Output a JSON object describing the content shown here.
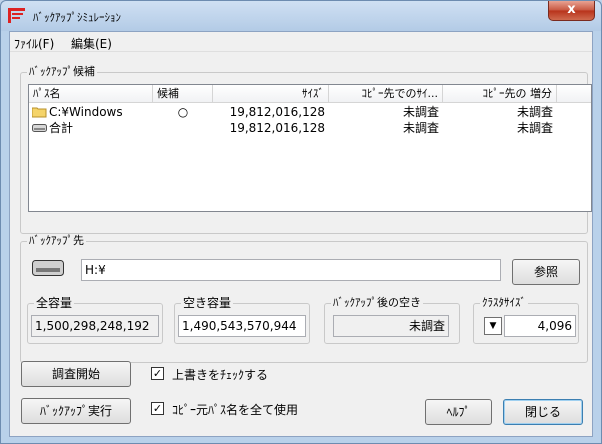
{
  "window": {
    "title": "ﾊﾞｯｸｱｯﾌﾟｼﾐｭﾚｰｼｮﾝ",
    "close_label": "x"
  },
  "menu": {
    "file": "ﾌｧｲﾙ(F)",
    "edit": "編集(E)"
  },
  "candidates": {
    "group_label": "ﾊﾞｯｸｱｯﾌﾟ候補",
    "columns": [
      "ﾊﾟｽ名",
      "候補",
      "ｻｲｽﾞ",
      "ｺﾋﾟｰ先でのｻｲ...",
      "ｺﾋﾟｰ先の 増分"
    ],
    "rows": [
      {
        "icon": "folder-icon",
        "path": "C:¥Windows",
        "candidate": "○",
        "size": "19,812,016,128",
        "dest_size": "未調査",
        "increment": "未調査"
      },
      {
        "icon": "drive-icon",
        "path": "合計",
        "candidate": "",
        "size": "19,812,016,128",
        "dest_size": "未調査",
        "increment": "未調査"
      }
    ]
  },
  "destination": {
    "group_label": "ﾊﾞｯｸｱｯﾌﾟ先",
    "path": "H:¥",
    "browse_label": "参照",
    "total_label": "全容量",
    "total_value": "1,500,298,248,192",
    "free_label": "空き容量",
    "free_value": "1,490,543,570,944",
    "after_label": "ﾊﾞｯｸｱｯﾌﾟ後の空き",
    "after_value": "未調査",
    "cluster_label": "ｸﾗｽﾀｻｲｽﾞ",
    "cluster_value": "4,096"
  },
  "actions": {
    "scan_label": "調査開始",
    "run_label": "ﾊﾞｯｸｱｯﾌﾟ実行",
    "overwrite_check_label": "上書きをﾁｪｯｸする",
    "overwrite_checked": "✓",
    "use_all_paths_label": "ｺﾋﾟｰ元ﾊﾟｽ名を全て使用",
    "use_all_paths_checked": "✓",
    "help_label": "ﾍﾙﾌﾟ",
    "close_label": "閉じる"
  }
}
